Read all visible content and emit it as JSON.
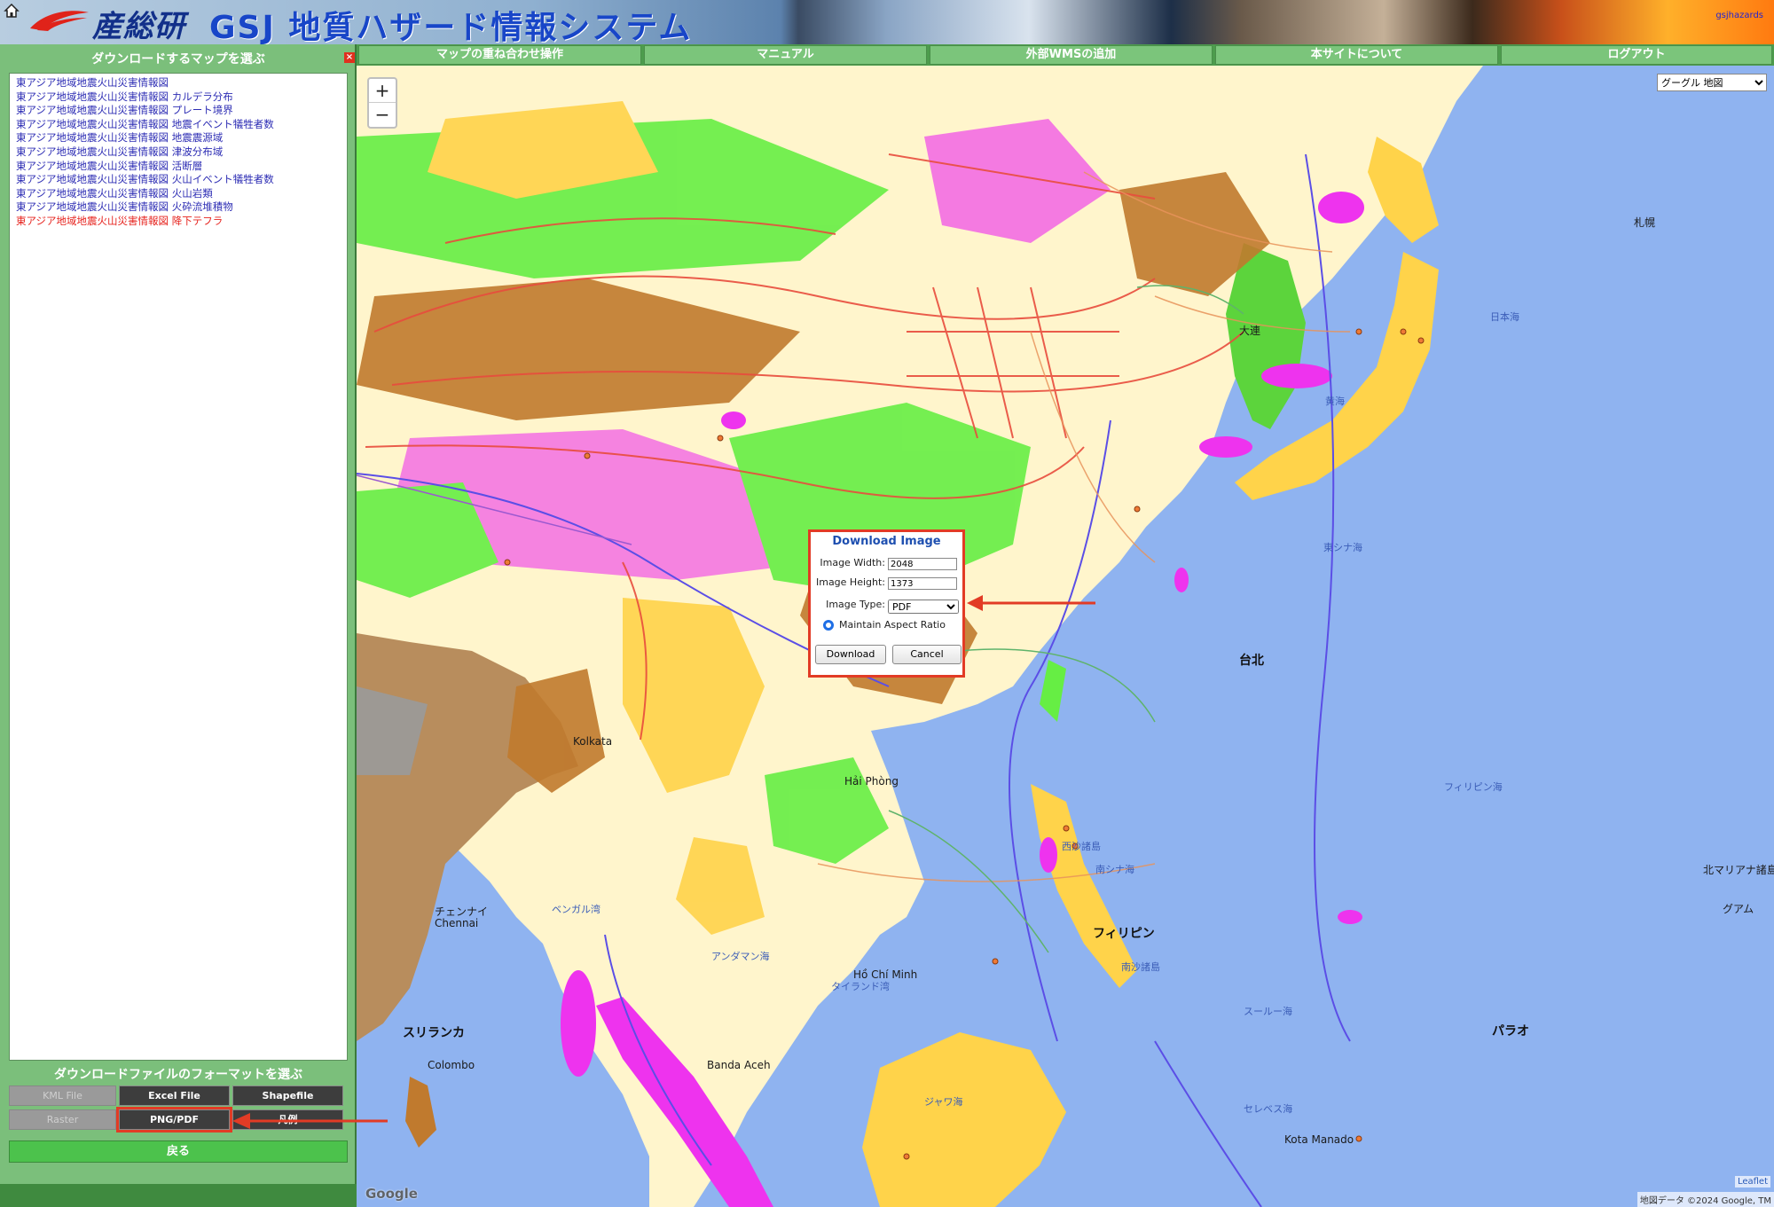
{
  "header": {
    "logo_text": "産総研",
    "title": "GSJ 地質ハザード情報システム",
    "user": "gsjhazards"
  },
  "panel": {
    "title": "ダウンロードするマップを選ぶ",
    "close_label": "×",
    "maps": [
      "東アジア地域地震火山災害情報図",
      "東アジア地域地震火山災害情報図 カルデラ分布",
      "東アジア地域地震火山災害情報図 プレート境界",
      "東アジア地域地震火山災害情報図 地震イベント犠牲者数",
      "東アジア地域地震火山災害情報図 地震震源域",
      "東アジア地域地震火山災害情報図 津波分布域",
      "東アジア地域地震火山災害情報図 活断層",
      "東アジア地域地震火山災害情報図 火山イベント犠牲者数",
      "東アジア地域地震火山災害情報図 火山岩類",
      "東アジア地域地震火山災害情報図 火砕流堆積物",
      "東アジア地域地震火山災害情報図 降下テフラ"
    ],
    "selected_index": 10,
    "format_title": "ダウンロードファイルのフォーマットを選ぶ",
    "formats": {
      "kml": "KML File",
      "excel": "Excel File",
      "shapefile": "Shapefile",
      "raster": "Raster",
      "pngpdf": "PNG/PDF",
      "legend": "凡例"
    },
    "back_label": "戻る"
  },
  "nav": {
    "items": [
      "マップの重ね合わせ操作",
      "マニュアル",
      "外部WMSの追加",
      "本サイトについて",
      "ログアウト"
    ]
  },
  "map": {
    "zoom_in": "+",
    "zoom_out": "−",
    "basemap": "グーグル 地図",
    "google": "Google",
    "leaflet": "Leaflet",
    "attribution": "地図データ ©2024 Google, TM",
    "labels": [
      "日本海",
      "黄海",
      "東シナ海",
      "フィリピン海",
      "南シナ海",
      "ベンガル湾",
      "アンダマン海",
      "タイランド湾",
      "西沙諸島",
      "南沙諸島",
      "スールー海",
      "セレベス海",
      "ジャワ海",
      "台北",
      "Kolkata",
      "チェンナイ",
      "Chennai",
      "Colombo",
      "Hải Phòng",
      "Hồ Chí Minh",
      "フィリピン",
      "パラオ",
      "北マリアナ諸島",
      "グアム",
      "スリランカ",
      "Kota Manado",
      "Banda Aceh",
      "大連",
      "札幌"
    ],
    "colors": {
      "ocean": "#8fb3f0",
      "land": "#fff5cc",
      "green": "#66ee44",
      "magenta": "#ee33ee",
      "brown": "#c07a2e",
      "fault": "#e84c3d",
      "plate": "#5b4ee6"
    }
  },
  "dialog": {
    "title": "Download Image",
    "width_label": "Image Width:",
    "width_value": "2048",
    "height_label": "Image Height:",
    "height_value": "1373",
    "type_label": "Image Type:",
    "type_value": "PDF",
    "aspect_label": "Maintain Aspect Ratio",
    "download_label": "Download",
    "cancel_label": "Cancel"
  }
}
